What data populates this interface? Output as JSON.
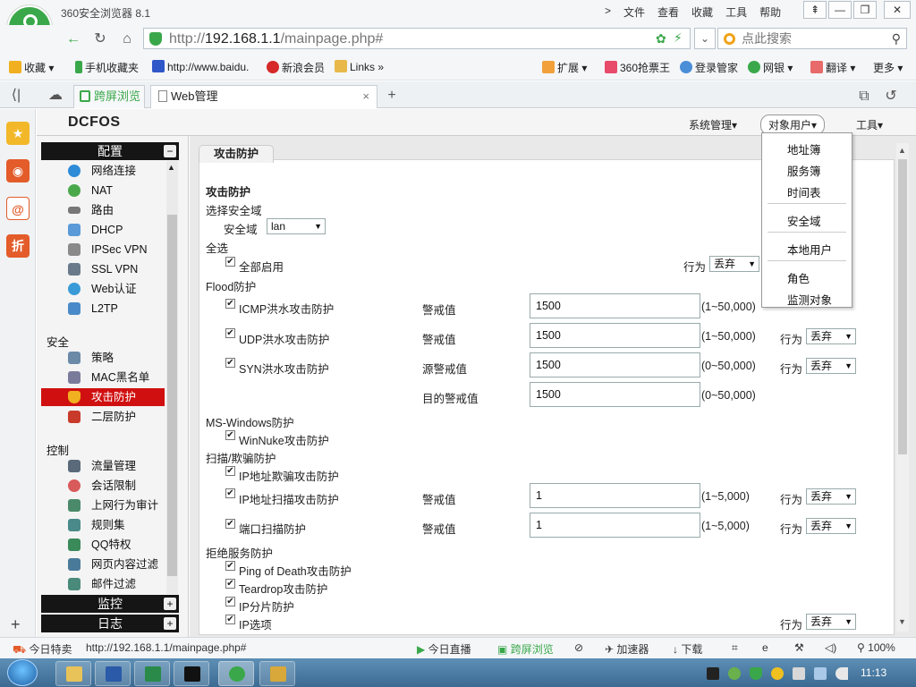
{
  "browser": {
    "app_title": "360安全浏览器 8.1",
    "menu": [
      "文件",
      "查看",
      "收藏",
      "工具",
      "帮助"
    ],
    "menu_chevron": ">",
    "url_prefix": "http://",
    "url_host": "192.168.1.1",
    "url_path": "/mainpage.php#",
    "search_placeholder": "点此搜索",
    "bookmarks": [
      "收藏",
      "手机收藏夹",
      "http://www.baidu.",
      "新浪会员",
      "Links",
      "扩展",
      "360抢票王",
      "登录管家",
      "网银",
      "翻译",
      "更多"
    ],
    "tabs": [
      {
        "label": "跨屏浏览"
      },
      {
        "label": "Web管理"
      }
    ],
    "colors": {
      "accent_green": "#3aa84a",
      "active_nav": "#d01010"
    }
  },
  "app": {
    "brand": "DCFOS",
    "top_menu": [
      "系统管理▾",
      "对象用户▾",
      "工具▾"
    ],
    "dropdown": [
      "地址簿",
      "服务簿",
      "时间表",
      "安全域",
      "本地用户",
      "角色",
      "监测对象"
    ]
  },
  "nav": {
    "config_header": "配置",
    "config_items": [
      "网络连接",
      "NAT",
      "路由",
      "DHCP",
      "IPSec VPN",
      "SSL VPN",
      "Web认证",
      "L2TP"
    ],
    "security_label": "安全",
    "security_items": [
      "策略",
      "MAC黑名单",
      "攻击防护",
      "二层防护"
    ],
    "control_label": "控制",
    "control_items": [
      "流量管理",
      "会话限制",
      "上网行为审计",
      "规则集",
      "QQ特权",
      "网页内容过滤",
      "邮件过滤"
    ],
    "monitor_header": "监控",
    "log_header": "日志"
  },
  "content": {
    "tab_title": "攻击防护",
    "heading": "攻击防护",
    "zone_section": "选择安全域",
    "zone_label": "安全域",
    "zone_value": "lan",
    "all_section": "全选",
    "enable_all": "全部启用",
    "action_label": "行为",
    "action_value": "丢弃",
    "flood_section": "Flood防护",
    "icmp": {
      "label": "ICMP洪水攻击防护",
      "field_label": "警戒值",
      "value": "1500",
      "range": "(1~50,000)"
    },
    "udp": {
      "label": "UDP洪水攻击防护",
      "field_label": "警戒值",
      "value": "1500",
      "range": "(1~50,000)",
      "action": "丢弃"
    },
    "syn": {
      "label": "SYN洪水攻击防护",
      "field_label": "源警戒值",
      "value": "1500",
      "range": "(0~50,000)",
      "action": "丢弃",
      "dest_label": "目的警戒值",
      "dest_value": "1500",
      "dest_range": "(0~50,000)"
    },
    "mswin_section": "MS-Windows防护",
    "winnuke": "WinNuke攻击防护",
    "scan_section": "扫描/欺骗防护",
    "ipspoof": "IP地址欺骗攻击防护",
    "ipscan": {
      "label": "IP地址扫描攻击防护",
      "field_label": "警戒值",
      "value": "1",
      "range": "(1~5,000)",
      "action": "丢弃"
    },
    "portscan": {
      "label": "端口扫描防护",
      "field_label": "警戒值",
      "value": "1",
      "range": "(1~5,000)",
      "action": "丢弃"
    },
    "dos_section": "拒绝服务防护",
    "pingofdeath": "Ping of Death攻击防护",
    "teardrop": "Teardrop攻击防护",
    "ipfrag": "IP分片防护",
    "ipopt": "IP选项",
    "ipopt_action_label": "行为",
    "ipopt_action": "丢弃",
    "check_mark": "✔"
  },
  "status": {
    "left": "今日特卖",
    "url": "http://192.168.1.1/mainpage.php#",
    "items": [
      "今日直播",
      "跨屏浏览",
      "加速器",
      "下载"
    ],
    "zoom": "100%"
  },
  "taskbar": {
    "clock": "11:13"
  }
}
